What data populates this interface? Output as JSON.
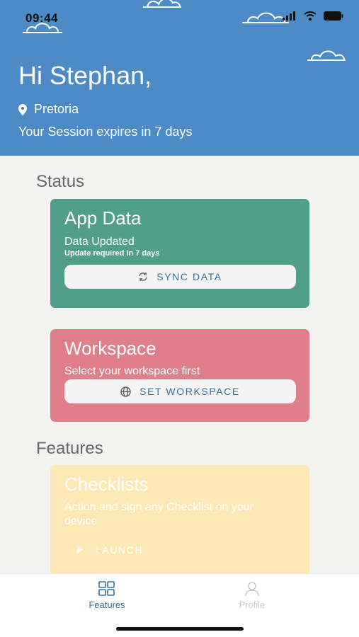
{
  "status_bar": {
    "time": "09:44"
  },
  "header": {
    "greeting": "Hi Stephan,",
    "location": "Pretoria",
    "session": "Your Session expires in 7 days",
    "bg_color": "#4d8bc6"
  },
  "sections": {
    "status": "Status",
    "features": "Features"
  },
  "app_data_card": {
    "title": "App Data",
    "subtitle": "Data Updated",
    "note": "Update required in 7 days",
    "button_label": "SYNC DATA",
    "color": "#519e8a"
  },
  "workspace_card": {
    "title": "Workspace",
    "subtitle": "Select your workspace first",
    "button_label": "SET WORKSPACE",
    "color": "#e07f89"
  },
  "checklists_card": {
    "title": "Checklists",
    "description": "Action and sign any Checklist on your device",
    "button_label": "LAUNCH",
    "color": "#fce7b5"
  },
  "tabbar": {
    "features_label": "Features",
    "profile_label": "Profile",
    "active_color": "#3a6f98",
    "inactive_color": "#c9c9c9"
  }
}
